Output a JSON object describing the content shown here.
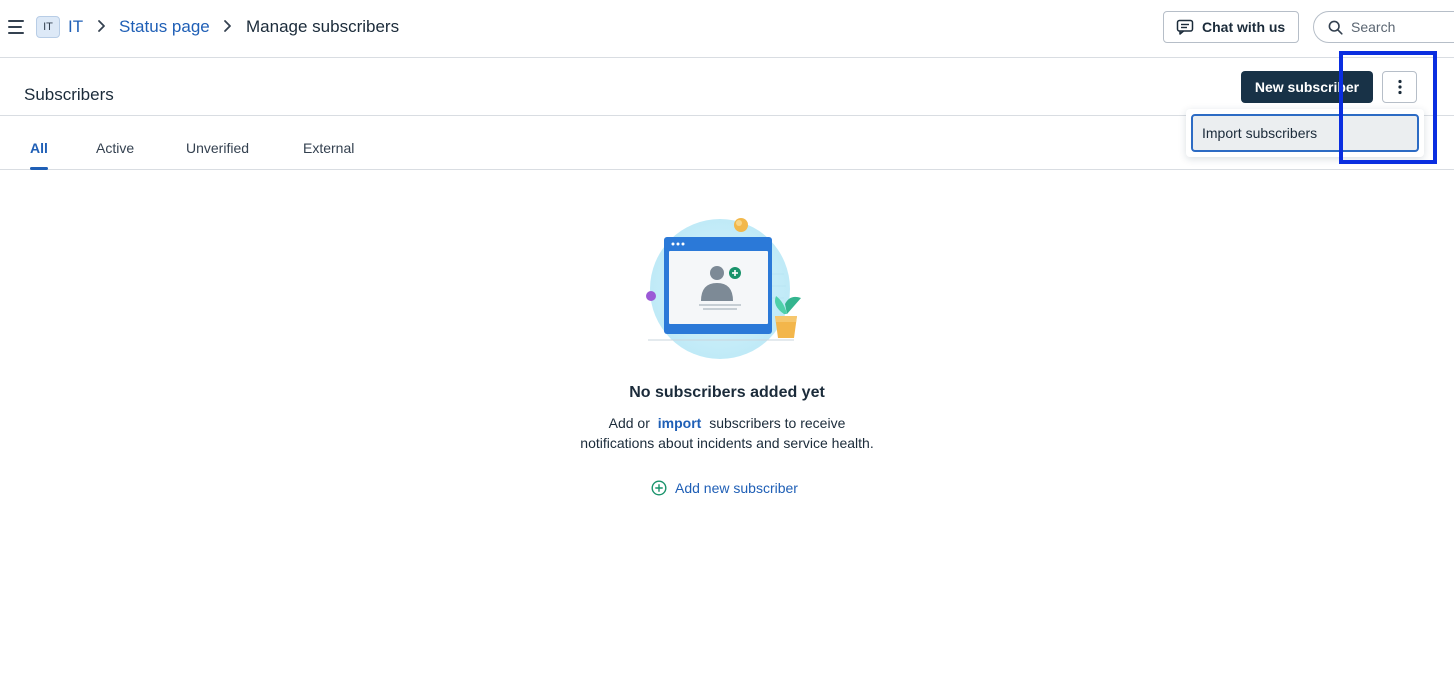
{
  "topbar": {
    "workspace_badge": "IT",
    "breadcrumbs": [
      "IT",
      "Status page",
      "Manage subscribers"
    ],
    "chat_label": "Chat with us",
    "search_placeholder": "Search"
  },
  "header": {
    "title": "Subscribers",
    "new_subscriber_label": "New subscriber"
  },
  "tabs": [
    "All",
    "Active",
    "Unverified",
    "External"
  ],
  "active_tab": "All",
  "dropdown": {
    "items": [
      "Import subscribers"
    ]
  },
  "empty_state": {
    "title": "No subscribers added yet",
    "desc_prefix": "Add or",
    "desc_link": "import",
    "desc_suffix": "subscribers to receive",
    "desc_line2": "notifications about incidents and service health.",
    "add_new_label": "Add new subscriber"
  },
  "colors": {
    "link": "#1f5fb6",
    "primary_button": "#183247",
    "highlight": "#0a2ee0",
    "success_accent": "#19936b"
  },
  "icons": [
    "menu-icon",
    "chevron-right-icon",
    "chat-icon",
    "search-icon",
    "more-vertical-icon",
    "add-circle-icon"
  ]
}
